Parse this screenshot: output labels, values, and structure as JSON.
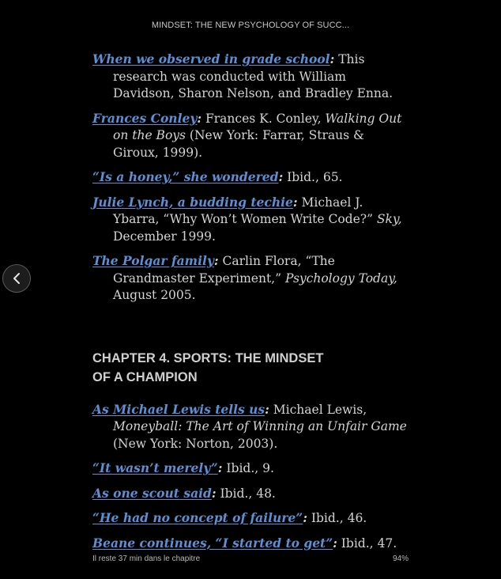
{
  "header": {
    "book_title": "MINDSET: THE NEW PSYCHOLOGY OF SUCC..."
  },
  "notes_top": [
    {
      "link": "When we observed in grade school",
      "rest": " This research was conducted with William Davidson, Sharon Nelson, and Bradley Enna."
    },
    {
      "link": "Frances Conley",
      "pre": " Frances K. Conley, ",
      "italic": "Walking Out on the Boys",
      "post": " (New York: Farrar, Straus & Giroux, 1999)."
    },
    {
      "link": "“Is a honey,” she wondered",
      "rest": " Ibid., 65."
    },
    {
      "link": "Julie Lynch, a budding techie",
      "pre": " Michael J. Ybarra, “Why Won’t Women Write Code?” ",
      "italic": "Sky,",
      "post": " December 1999."
    },
    {
      "link": "The Polgar family",
      "pre": " Carlin Flora, “The Grandmaster Ex­periment,” ",
      "italic": "Psychology Today,",
      "post": " August 2005."
    }
  ],
  "chapter": {
    "title": "CHAPTER 4. SPORTS: THE MINDSET OF A CHAMPION"
  },
  "notes_bottom": [
    {
      "link": "As Michael Lewis tells us",
      "pre": " Michael Lewis, ",
      "italic": "Moneyball: The Art of Winning an Unfair Game",
      "post": " (New York: Norton, 2003)."
    },
    {
      "link": "“It wasn’t merely”",
      "rest": " Ibid., 9."
    },
    {
      "link": "As one scout said",
      "rest": " Ibid., 48."
    },
    {
      "link": "“He had no concept of failure”",
      "rest": " Ibid., 46."
    },
    {
      "link": "Beane continues, “I started to get”",
      "rest": " Ibid., 47."
    }
  ],
  "footer": {
    "time_left": "Il reste 37 min dans le chapitre",
    "progress": "94%"
  },
  "nav": {
    "back_icon": "chevron-left-icon"
  },
  "colors": {
    "background": "#000000",
    "link": "#5d8fd3",
    "text": "#d4d4d4"
  }
}
